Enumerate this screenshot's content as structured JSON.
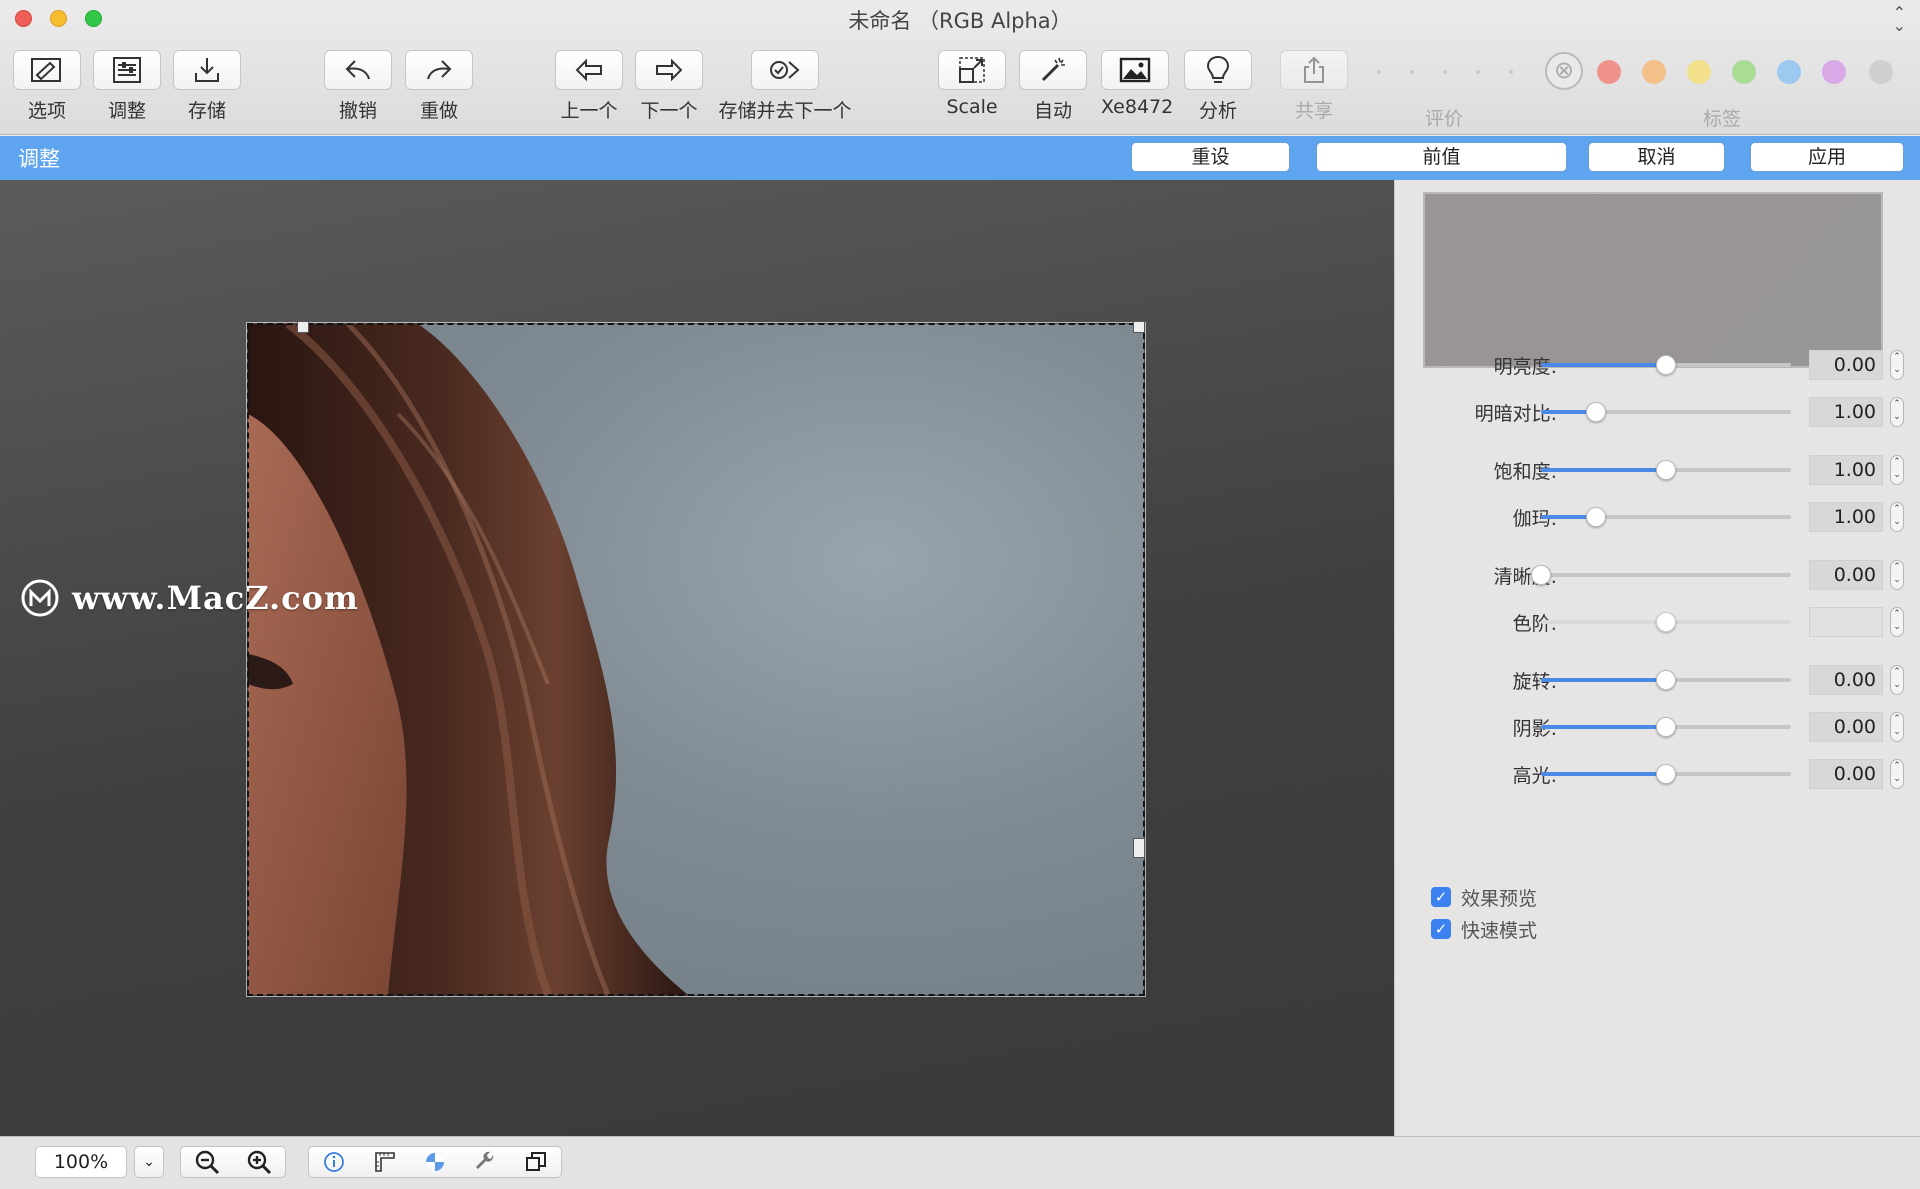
{
  "window": {
    "title": "未命名 （RGB Alpha）",
    "stepper": "⌃\n⌄"
  },
  "toolbar": {
    "items": [
      {
        "label": "选项",
        "icon": "options-icon"
      },
      {
        "label": "调整",
        "icon": "sliders-icon"
      },
      {
        "label": "存储",
        "icon": "save-download-icon"
      },
      {
        "label": "撤销",
        "icon": "undo-icon"
      },
      {
        "label": "重做",
        "icon": "redo-icon"
      },
      {
        "label": "上一个",
        "icon": "arrow-left-icon"
      },
      {
        "label": "下一个",
        "icon": "arrow-right-icon"
      },
      {
        "label": "存储并去下一个",
        "icon": "save-next-icon"
      },
      {
        "label": "Scale",
        "icon": "scale-icon"
      },
      {
        "label": "自动",
        "icon": "magic-wand-icon"
      },
      {
        "label": "Xe8472",
        "icon": "image-icon"
      },
      {
        "label": "分析",
        "icon": "lightbulb-icon"
      },
      {
        "label": "共享",
        "icon": "share-icon"
      }
    ],
    "rating_label": "评价",
    "tags_label": "标签",
    "tag_colors": [
      "#f0938c",
      "#f3c08a",
      "#f2e08a",
      "#a9dd93",
      "#9dc9f0",
      "#d9a8e6",
      "#cfcfcf"
    ]
  },
  "adjust_bar": {
    "title": "调整",
    "reset": "重设",
    "previous": "前值",
    "cancel": "取消",
    "apply": "应用"
  },
  "watermark": "www.MacZ.com",
  "adjustments": [
    {
      "label": "明亮度:",
      "value": "0.00",
      "position": 0.5,
      "enabled": true
    },
    {
      "label": "明暗对比:",
      "value": "1.00",
      "position": 0.22,
      "enabled": true
    },
    {
      "label": "饱和度:",
      "value": "1.00",
      "position": 0.5,
      "enabled": true
    },
    {
      "label": "伽玛:",
      "value": "1.00",
      "position": 0.22,
      "enabled": true
    },
    {
      "label": "清晰度:",
      "value": "0.00",
      "position": 0.0,
      "enabled": true
    },
    {
      "label": "色阶:",
      "value": "",
      "position": 0.5,
      "enabled": false
    },
    {
      "label": "旋转:",
      "value": "0.00",
      "position": 0.5,
      "enabled": true
    },
    {
      "label": "阴影:",
      "value": "0.00",
      "position": 0.5,
      "enabled": true
    },
    {
      "label": "高光:",
      "value": "0.00",
      "position": 0.5,
      "enabled": true
    }
  ],
  "options": {
    "preview_effect": "效果预览",
    "fast_mode": "快速模式"
  },
  "statusbar": {
    "zoom": "100%"
  }
}
